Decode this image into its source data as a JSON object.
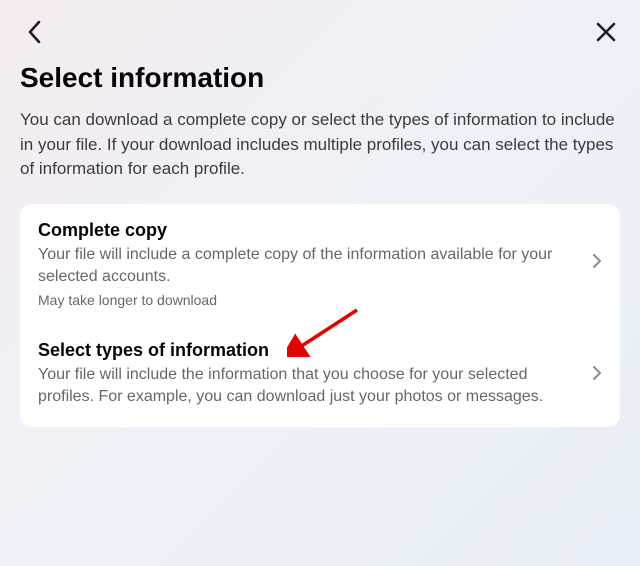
{
  "header": {
    "title": "Select information",
    "description": "You can download a complete copy or select the types of information to include in your file. If your download includes multiple profiles, you can select the types of information for each profile."
  },
  "options": {
    "complete": {
      "title": "Complete copy",
      "desc": "Your file will include a complete copy of the information available for your selected accounts.",
      "note": "May take longer to download"
    },
    "select": {
      "title": "Select types of information",
      "desc": "Your file will include the information that you choose for your selected profiles. For example, you can download just your photos or messages."
    }
  }
}
